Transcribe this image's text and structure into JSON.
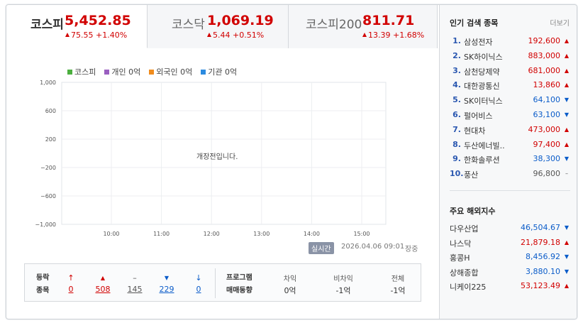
{
  "tabs": [
    {
      "name": "코스피",
      "value": "5,452.85",
      "change": "75.55 +1.40%",
      "active": true
    },
    {
      "name": "코스닥",
      "value": "1,069.19",
      "change": "5.44 +0.51%",
      "active": false
    },
    {
      "name": "코스피200",
      "value": "811.71",
      "change": "13.39 +1.68%",
      "active": false
    }
  ],
  "legend": [
    {
      "label": "코스피",
      "color": "#4caf3f"
    },
    {
      "label": "개인 0억",
      "color": "#9a5fc0"
    },
    {
      "label": "외국인 0억",
      "color": "#f08c1e"
    },
    {
      "label": "기관 0억",
      "color": "#2b8be0"
    }
  ],
  "chart_data": {
    "type": "line",
    "yticks": [
      "1,000",
      "600",
      "200",
      "−200",
      "−600",
      "−1,000"
    ],
    "xticks": [
      "10:00",
      "11:00",
      "12:00",
      "13:00",
      "14:00",
      "15:00"
    ],
    "ylim": [
      -1000,
      1000
    ],
    "message": "개장전입니다.",
    "grid": true,
    "series": []
  },
  "status": {
    "realtime": "실시간",
    "timestamp": "2026.04.06 09:01",
    "state": "장중"
  },
  "breadth": {
    "label_line1": "등락",
    "label_line2": "종목",
    "items": [
      {
        "icon": "↑",
        "count": "0",
        "color": "red"
      },
      {
        "icon": "▲",
        "count": "508",
        "color": "red"
      },
      {
        "icon": "–",
        "count": "145",
        "color": "gray"
      },
      {
        "icon": "▼",
        "count": "229",
        "color": "blue"
      },
      {
        "icon": "↓",
        "count": "0",
        "color": "blue"
      }
    ],
    "program_line1": "프로그램",
    "program_line2": "매매동향",
    "program": [
      {
        "head": "차익",
        "value": "0억"
      },
      {
        "head": "비차익",
        "value": "-1억"
      },
      {
        "head": "전체",
        "value": "-1억"
      }
    ]
  },
  "popular": {
    "title": "인기 검색 종목",
    "more": "더보기",
    "items": [
      {
        "rank": "1.",
        "name": "삼성전자",
        "price": "192,600",
        "dir": "up"
      },
      {
        "rank": "2.",
        "name": "SK하이닉스",
        "price": "883,000",
        "dir": "up"
      },
      {
        "rank": "3.",
        "name": "삼천당제약",
        "price": "681,000",
        "dir": "up"
      },
      {
        "rank": "4.",
        "name": "대한광통신",
        "price": "13,860",
        "dir": "up"
      },
      {
        "rank": "5.",
        "name": "SK이터닉스",
        "price": "64,100",
        "dir": "down"
      },
      {
        "rank": "6.",
        "name": "펄어비스",
        "price": "63,100",
        "dir": "down"
      },
      {
        "rank": "7.",
        "name": "현대차",
        "price": "473,000",
        "dir": "up"
      },
      {
        "rank": "8.",
        "name": "두산에너빌..",
        "price": "97,400",
        "dir": "up"
      },
      {
        "rank": "9.",
        "name": "한화솔루션",
        "price": "38,300",
        "dir": "down"
      },
      {
        "rank": "10.",
        "name": "풍산",
        "price": "96,800",
        "dir": "flat"
      }
    ]
  },
  "overseas": {
    "title": "주요 해외지수",
    "items": [
      {
        "name": "다우산업",
        "value": "46,504.67",
        "dir": "down"
      },
      {
        "name": "나스닥",
        "value": "21,879.18",
        "dir": "up"
      },
      {
        "name": "홍콩H",
        "value": "8,456.92",
        "dir": "down"
      },
      {
        "name": "상해종합",
        "value": "3,880.10",
        "dir": "down"
      },
      {
        "name": "니케이225",
        "value": "53,123.49",
        "dir": "up"
      }
    ]
  }
}
